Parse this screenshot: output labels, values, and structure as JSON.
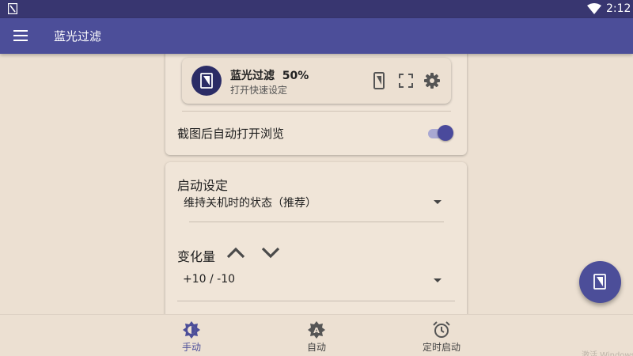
{
  "status_bar": {
    "time": "2:12",
    "icons": [
      "notification-icon",
      "wifi-icon"
    ]
  },
  "app_bar": {
    "title": "蓝光过滤",
    "menu_icon": "menu-icon"
  },
  "quick_tile": {
    "title": "蓝光过滤  50%",
    "subtitle": "打开快速设定",
    "icons": [
      "filter-icon",
      "phone-icon",
      "fullscreen-icon",
      "settings-icon"
    ]
  },
  "screenshot_option": {
    "label": "截图后自动打开浏览",
    "enabled": true
  },
  "startup": {
    "title": "启动设定",
    "selected": "维持关机时的状态（推荐）"
  },
  "delta": {
    "title": "变化量",
    "selected": "+10 / -10",
    "icons": [
      "chevron-up-icon",
      "chevron-down-icon"
    ]
  },
  "fab": {
    "icon": "filter-icon"
  },
  "bottom_nav": {
    "items": [
      {
        "label": "手动",
        "icon": "brightness-icon",
        "active": true
      },
      {
        "label": "自动",
        "icon": "auto-brightness-icon",
        "active": false
      },
      {
        "label": "定时启动",
        "icon": "alarm-icon",
        "active": false
      }
    ]
  },
  "colors": {
    "primary": "#4c4e99",
    "status_bar": "#383670",
    "background": "#ece0d2",
    "accent": "#4a4a9c"
  },
  "watermark": "激活 Windows"
}
